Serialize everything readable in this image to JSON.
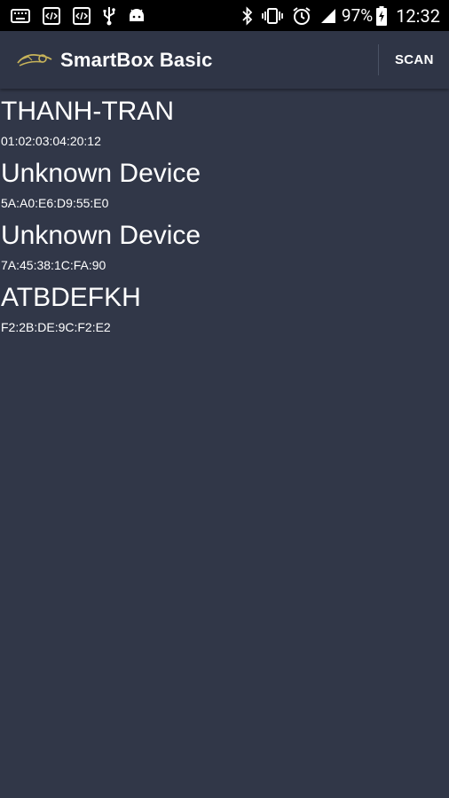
{
  "status_bar": {
    "battery_percent": "97%",
    "time": "12:32",
    "icons": [
      "keyboard-icon",
      "code-icon",
      "code-icon",
      "usb-icon",
      "android-icon",
      "bluetooth-icon",
      "vibrate-icon",
      "alarm-icon",
      "signal-icon",
      "battery-charging-icon"
    ]
  },
  "app_bar": {
    "title": "SmartBox Basic",
    "scan_label": "SCAN"
  },
  "devices": [
    {
      "name": "THANH-TRAN",
      "address": "01:02:03:04:20:12"
    },
    {
      "name": "Unknown Device",
      "address": "5A:A0:E6:D9:55:E0"
    },
    {
      "name": "Unknown Device",
      "address": "7A:45:38:1C:FA:90"
    },
    {
      "name": "ATBDEFKH",
      "address": "F2:2B:DE:9C:F2:E2"
    }
  ],
  "colors": {
    "background": "#313748",
    "app_bar": "#2f3546",
    "status_bar": "#000000",
    "text": "#ffffff"
  }
}
